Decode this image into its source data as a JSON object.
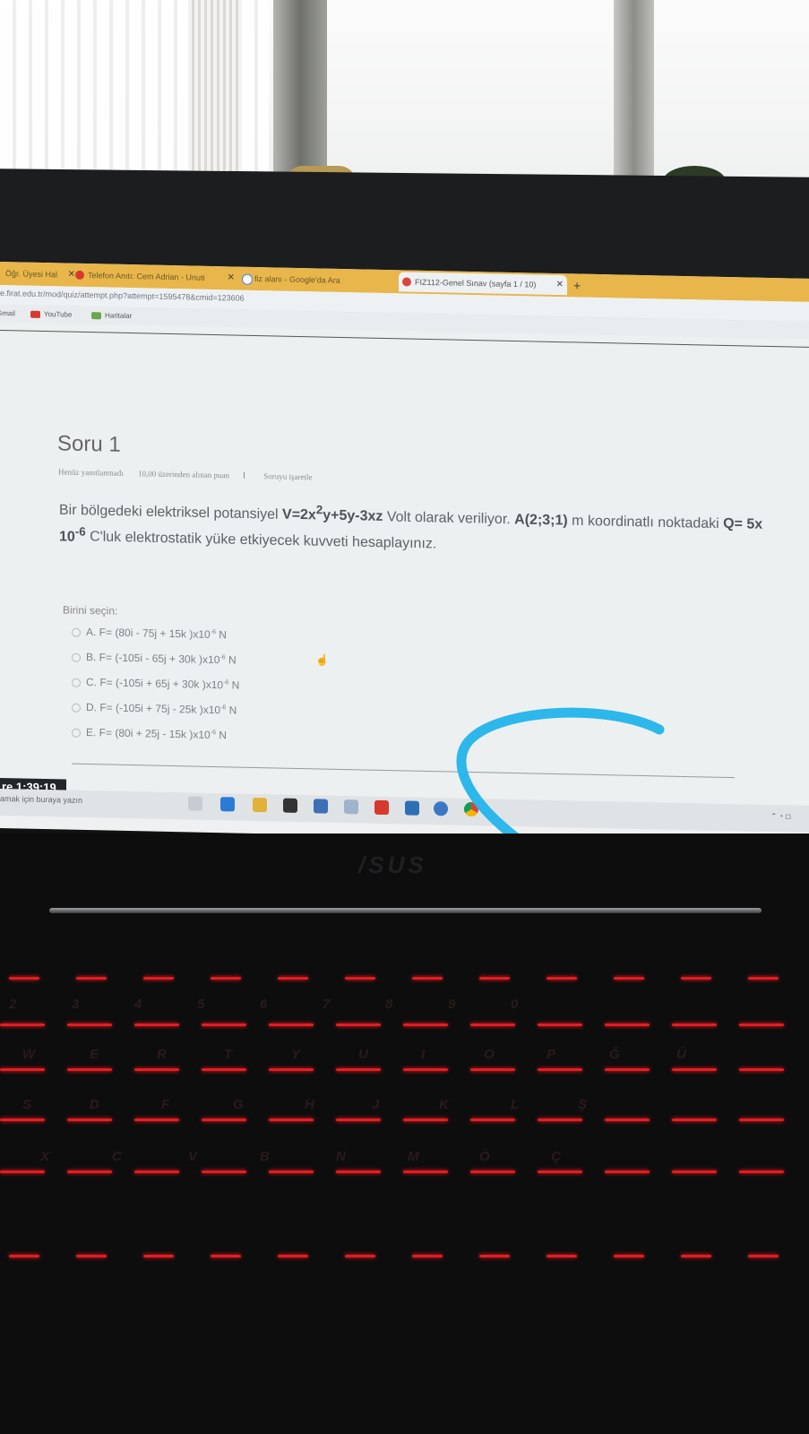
{
  "browser": {
    "tabs": [
      {
        "label": "Öğr. Üyesi Hal"
      },
      {
        "label": "Telefon Anıtı: Cem Adrian - Unuti"
      },
      {
        "label": "fiz alanı - Google'da Ara"
      },
      {
        "label": "FIZ112-Genel Sınav (sayfa 1 / 10)"
      }
    ],
    "new_tab_symbol": "+",
    "url": "e.firat.edu.tr/mod/quiz/attempt.php?attempt=1595478&cmid=123606",
    "bookmarks": [
      "Gmail",
      "YouTube",
      "Haritalar"
    ]
  },
  "quiz": {
    "title": "Soru 1",
    "status": "Henüz yanıtlanmadı",
    "points": "10,00 üzerinden alınan puan",
    "flag_label": "Soruyu işaretle",
    "question_parts": {
      "p1": "Bir bölgedeki elektriksel potansiyel ",
      "v_formula_a": "V=2x",
      "v_sup": "2",
      "v_formula_b": "y+5y-3xz",
      "p2": " Volt olarak veriliyor. ",
      "point": "A(2;3;1)",
      "p3": " m koordinatlı noktadaki ",
      "charge_a": "Q= 5x 10",
      "charge_sup": "-6",
      "p4": " C'luk elektrostatik yüke etkiyecek kuvveti hesaplayınız."
    },
    "select_label": "Birini seçin:",
    "options": [
      {
        "text": "A. F= (80i - 75j + 15k )x10",
        "exp": "-6",
        "unit": " N"
      },
      {
        "text": "B. F= (-105i - 65j + 30k )x10",
        "exp": "-6",
        "unit": " N"
      },
      {
        "text": "C. F= (-105i + 65j + 30k )x10",
        "exp": "-6",
        "unit": " N"
      },
      {
        "text": "D. F= (-105i + 75j - 25k )x10",
        "exp": "-6",
        "unit": " N"
      },
      {
        "text": "E. F= (80i + 25j - 15k )x10",
        "exp": "-6",
        "unit": " N"
      }
    ]
  },
  "timer": "re 1:39:19",
  "taskbar": {
    "search_text": "amak için buraya yazın"
  },
  "laptop": {
    "brand": "/SUS"
  },
  "keyboard": {
    "row_labels": [
      [
        "2",
        "3",
        "4",
        "5",
        "6",
        "7",
        "8",
        "9",
        "0"
      ],
      [
        "W",
        "E",
        "R",
        "T",
        "Y",
        "U",
        "I",
        "O",
        "P",
        "Ğ",
        "Ü"
      ],
      [
        "S",
        "D",
        "F",
        "G",
        "H",
        "J",
        "K",
        "L",
        "Ş"
      ],
      [
        "X",
        "C",
        "V",
        "B",
        "N",
        "M",
        "Ö",
        "Ç"
      ]
    ]
  },
  "colors": {
    "tab_bar": "#e8b64a",
    "annotation_stroke": "#2db7ea",
    "key_backlight": "#e21d24"
  }
}
